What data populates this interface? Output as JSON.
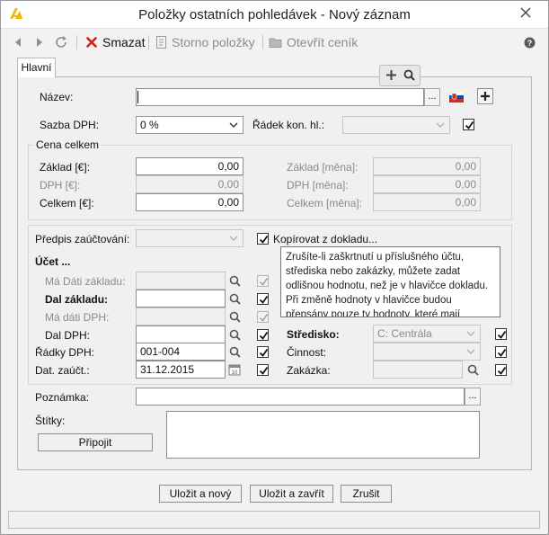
{
  "window": {
    "title": "Položky ostatních pohledávek - Nový záznam",
    "icons": {
      "logo": "app-logo",
      "close": "close-x-icon"
    }
  },
  "toolbar": {
    "back_icon": "arrow-left-icon",
    "forward_icon": "arrow-right-icon",
    "refresh_icon": "refresh-icon",
    "delete_label": "Smazat",
    "storno_label": "Storno položky",
    "pricelist_label": "Otevřít ceník",
    "help_icon": "help-icon"
  },
  "tabs": [
    {
      "label": "Hlavní",
      "active": true
    }
  ],
  "pane_tools": {
    "add_icon": "plus-icon",
    "search_icon": "search-icon"
  },
  "form": {
    "nazev": {
      "label": "Název:",
      "value": "",
      "more_button": "...",
      "flag_icon": "slovak-flag-icon",
      "add_icon": "plus-icon"
    },
    "sazba_dph": {
      "label": "Sazba DPH:",
      "value": "0 %"
    },
    "radek_kon_hl": {
      "label": "Řádek kon. hl.:",
      "value": "",
      "checked": true
    },
    "cena_celkem": {
      "title": "Cena celkem",
      "zaklad": {
        "label": "Základ [€]:",
        "value": "0,00"
      },
      "dph": {
        "label": "DPH [€]:",
        "value": "0,00"
      },
      "celkem": {
        "label": "Celkem [€]:",
        "value": "0,00"
      },
      "zaklad_mena": {
        "label": "Základ [měna]:",
        "value": "0,00"
      },
      "dph_mena": {
        "label": "DPH [měna]:",
        "value": "0,00"
      },
      "celkem_mena": {
        "label": "Celkem [měna]:",
        "value": "0,00"
      }
    },
    "predpis": {
      "label": "Předpis zaúčtování:",
      "value": ""
    },
    "kopirovat": {
      "label": "Kopírovat z dokladu...",
      "checked": true
    },
    "ucet": {
      "title": "Účet ...",
      "ma_dati_zakladu": {
        "label": "Má Dáti základu:",
        "value": "",
        "checked": true
      },
      "dal_zakladu": {
        "label": "Dal základu:",
        "value": "",
        "checked": true
      },
      "ma_dati_dph": {
        "label": "Má dáti DPH:",
        "value": "",
        "checked": true
      },
      "dal_dph": {
        "label": "Dal DPH:",
        "value": "",
        "checked": true
      }
    },
    "radky_dph": {
      "label": "Řádky DPH:",
      "value": "001-004",
      "checked": true
    },
    "dat_zauct": {
      "label": "Dat. zaúčt.:",
      "value": "31.12.2015",
      "checked": true,
      "calendar_icon": "calendar-icon"
    },
    "stredisko": {
      "label": "Středisko:",
      "value": "C: Centrála",
      "checked": true
    },
    "cinnost": {
      "label": "Činnost:",
      "value": "",
      "checked": true
    },
    "zakazka": {
      "label": "Zakázka:",
      "value": "",
      "checked": true
    },
    "tooltip": "Zrušíte-li zaškrtnutí u příslušného účtu, střediska nebo zakázky, můžete zadat odlišnou hodnotu, než je v hlavičce dokladu. Při změně hodnoty v hlavičce budou přepsány pouze ty hodnoty, které mají zaškrtnuto \"Kopírovat z...",
    "poznamka": {
      "label": "Poznámka:",
      "value": "",
      "more_button": "..."
    },
    "stitky": {
      "label": "Štítky:",
      "attach_button": "Připojit"
    }
  },
  "footer": {
    "save_new": "Uložit a nový",
    "save_close": "Uložit a zavřít",
    "cancel": "Zrušit"
  },
  "colors": {
    "delete_red": "#d11f1f",
    "accent_yellow": "#f2b705",
    "flag_red": "#d52b1e",
    "flag_blue": "#0b4ea2"
  }
}
